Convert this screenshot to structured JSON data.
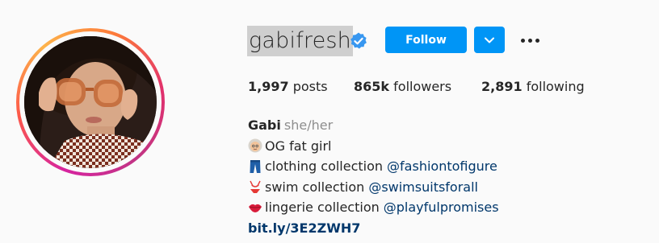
{
  "profile": {
    "username": "gabifresh",
    "follow_label": "Follow",
    "stats": {
      "posts_count": "1,997",
      "posts_label": "posts",
      "followers_count": "865k",
      "followers_label": "followers",
      "following_count": "2,891",
      "following_label": "following"
    },
    "bio": {
      "name": "Gabi",
      "pronouns": "she/her",
      "line1_text": "OG fat girl",
      "line1_emoji": "older-woman-emoji",
      "line2_text": "clothing collection",
      "line2_mention": "@fashiontofigure",
      "line2_emoji": "jeans-emoji",
      "line3_text": "swim collection",
      "line3_mention": "@swimsuitsforall",
      "line3_emoji": "bikini-emoji",
      "line4_text": "lingerie collection",
      "line4_mention": "@playfulpromises",
      "line4_emoji": "lips-emoji",
      "link": "bit.ly/3E2ZWH7"
    }
  },
  "colors": {
    "accent": "#0095f6",
    "verified": "#3897f0",
    "link": "#00376b",
    "secondary_text": "#8e8e8e",
    "background": "#fafafa"
  },
  "icons": {
    "verified": "verified-badge-icon",
    "dropdown": "chevron-down-icon",
    "more": "more-options-icon"
  }
}
